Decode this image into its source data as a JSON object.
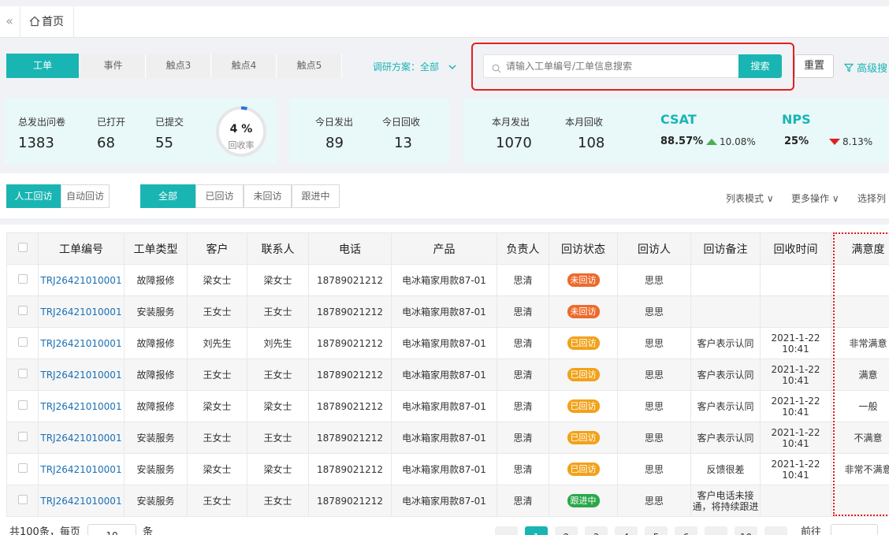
{
  "topbar": {
    "collapse_glyph": "«",
    "home_label": "首页"
  },
  "toolbar": {
    "type_tabs": [
      "工单",
      "事件",
      "触点3",
      "触点4",
      "触点5"
    ],
    "scheme_label": "调研方案：",
    "scheme_value": "全部",
    "search_placeholder": "请输入工单编号/工单信息搜索",
    "search_button": "搜索",
    "reset_button": "重置",
    "advanced_button": "高级搜"
  },
  "stats": {
    "total_sent_label": "总发出问卷",
    "total_sent": "1383",
    "opened_label": "已打开",
    "opened": "68",
    "submitted_label": "已提交",
    "submitted": "55",
    "recovery_pct": "4 %",
    "recovery_label": "回收率",
    "recovery_fraction": 0.04,
    "today_sent_label": "今日发出",
    "today_sent": "89",
    "today_recv_label": "今日回收",
    "today_recv": "13",
    "month_sent_label": "本月发出",
    "month_sent": "1070",
    "month_recv_label": "本月回收",
    "month_recv": "108",
    "csat_title": "CSAT",
    "csat_value": "88.57%",
    "csat_change": "10.08%",
    "nps_title": "NPS",
    "nps_value": "25%",
    "nps_change": "8.13%"
  },
  "filters": {
    "mode_tabs": [
      "人工回访",
      "自动回访"
    ],
    "status_tabs": [
      "全部",
      "已回访",
      "未回访",
      "跟进中"
    ],
    "list_mode": "列表模式 ∨",
    "more_ops": "更多操作 ∨",
    "choose_cols": "选择列"
  },
  "table": {
    "headers": [
      "工单编号",
      "工单类型",
      "客户",
      "联系人",
      "电话",
      "产品",
      "负责人",
      "回访状态",
      "回访人",
      "回访备注",
      "回收时间",
      "满意度"
    ],
    "rows": [
      {
        "id": "TRJ26421010001",
        "type": "故障报修",
        "customer": "梁女士",
        "contact": "梁女士",
        "phone": "18789021212",
        "product": "电冰箱家用款87-01",
        "owner": "思清",
        "status": "未回访",
        "visitor": "思思",
        "note": "",
        "time1": "",
        "time2": "",
        "satisfaction": ""
      },
      {
        "id": "TRJ26421010001",
        "type": "安装服务",
        "customer": "王女士",
        "contact": "王女士",
        "phone": "18789021212",
        "product": "电冰箱家用款87-01",
        "owner": "思清",
        "status": "未回访",
        "visitor": "思思",
        "note": "",
        "time1": "",
        "time2": "",
        "satisfaction": ""
      },
      {
        "id": "TRJ26421010001",
        "type": "故障报修",
        "customer": "刘先生",
        "contact": "刘先生",
        "phone": "18789021212",
        "product": "电冰箱家用款87-01",
        "owner": "思清",
        "status": "已回访",
        "visitor": "思思",
        "note": "客户表示认同",
        "time1": "2021-1-22",
        "time2": "10:41",
        "satisfaction": "非常满意"
      },
      {
        "id": "TRJ26421010001",
        "type": "故障报修",
        "customer": "王女士",
        "contact": "王女士",
        "phone": "18789021212",
        "product": "电冰箱家用款87-01",
        "owner": "思清",
        "status": "已回访",
        "visitor": "思思",
        "note": "客户表示认同",
        "time1": "2021-1-22",
        "time2": "10:41",
        "satisfaction": "满意"
      },
      {
        "id": "TRJ26421010001",
        "type": "故障报修",
        "customer": "梁女士",
        "contact": "梁女士",
        "phone": "18789021212",
        "product": "电冰箱家用款87-01",
        "owner": "思清",
        "status": "已回访",
        "visitor": "思思",
        "note": "客户表示认同",
        "time1": "2021-1-22",
        "time2": "10:41",
        "satisfaction": "一般"
      },
      {
        "id": "TRJ26421010001",
        "type": "安装服务",
        "customer": "王女士",
        "contact": "王女士",
        "phone": "18789021212",
        "product": "电冰箱家用款87-01",
        "owner": "思清",
        "status": "已回访",
        "visitor": "思思",
        "note": "客户表示认同",
        "time1": "2021-1-22",
        "time2": "10:41",
        "satisfaction": "不满意"
      },
      {
        "id": "TRJ26421010001",
        "type": "安装服务",
        "customer": "梁女士",
        "contact": "梁女士",
        "phone": "18789021212",
        "product": "电冰箱家用款87-01",
        "owner": "思清",
        "status": "已回访",
        "visitor": "思思",
        "note": "反馈很差",
        "time1": "2021-1-22",
        "time2": "10:41",
        "satisfaction": "非常不满意"
      },
      {
        "id": "TRJ26421010001",
        "type": "安装服务",
        "customer": "王女士",
        "contact": "王女士",
        "phone": "18789021212",
        "product": "电冰箱家用款87-01",
        "owner": "思清",
        "status": "跟进中",
        "visitor": "思思",
        "note": "客户电话未接通，将持续跟进",
        "time1": "",
        "time2": "",
        "satisfaction": ""
      }
    ],
    "status_colors": {
      "未回访": "#ec6a2c",
      "已回访": "#f1a21a",
      "跟进中": "#2aa84a"
    }
  },
  "pager": {
    "total": "共100条，每页",
    "page_size": "10",
    "unit": "条",
    "pages": [
      "<",
      "1",
      "2",
      "3",
      "4",
      "5",
      "6",
      "...",
      "10",
      ">"
    ],
    "current_page": "1",
    "goto_label": "前往"
  },
  "colors": {
    "accent": "#19b5b3",
    "highlight_border": "#e02020",
    "link": "#1a6fb5"
  }
}
